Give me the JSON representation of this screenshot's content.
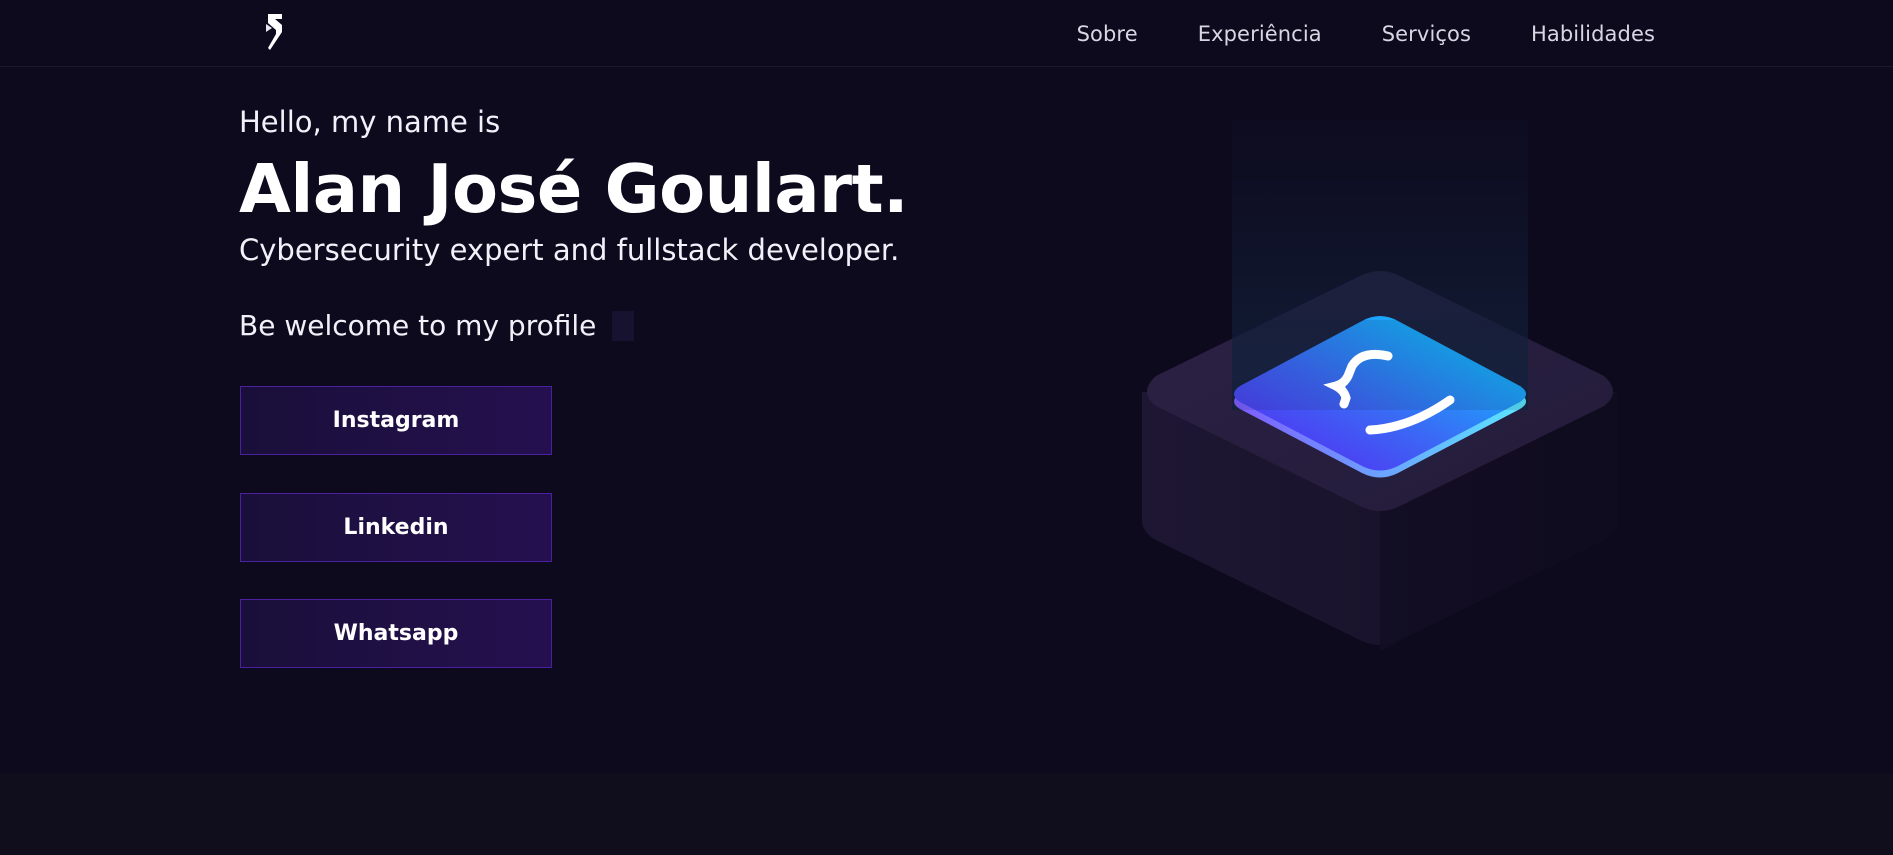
{
  "header": {
    "logo_icon": "brand-logo-icon",
    "nav": [
      {
        "label": "Sobre"
      },
      {
        "label": "Experiência"
      },
      {
        "label": "Serviços"
      },
      {
        "label": "Habilidades"
      }
    ]
  },
  "hero": {
    "greeting": "Hello, my name is",
    "name": "Alan José Goulart.",
    "tagline": "Cybersecurity expert and fullstack developer.",
    "welcome": "Be welcome to my profile"
  },
  "buttons": {
    "instagram": "Instagram",
    "linkedin": "Linkedin",
    "whatsapp": "Whatsapp"
  },
  "illustration": {
    "icon": "code-braces-icon"
  },
  "colors": {
    "background": "#0e0a1e",
    "button_border": "#4a1fa0",
    "accent_cyan": "#00d4ff",
    "accent_purple": "#5b2cf0"
  }
}
